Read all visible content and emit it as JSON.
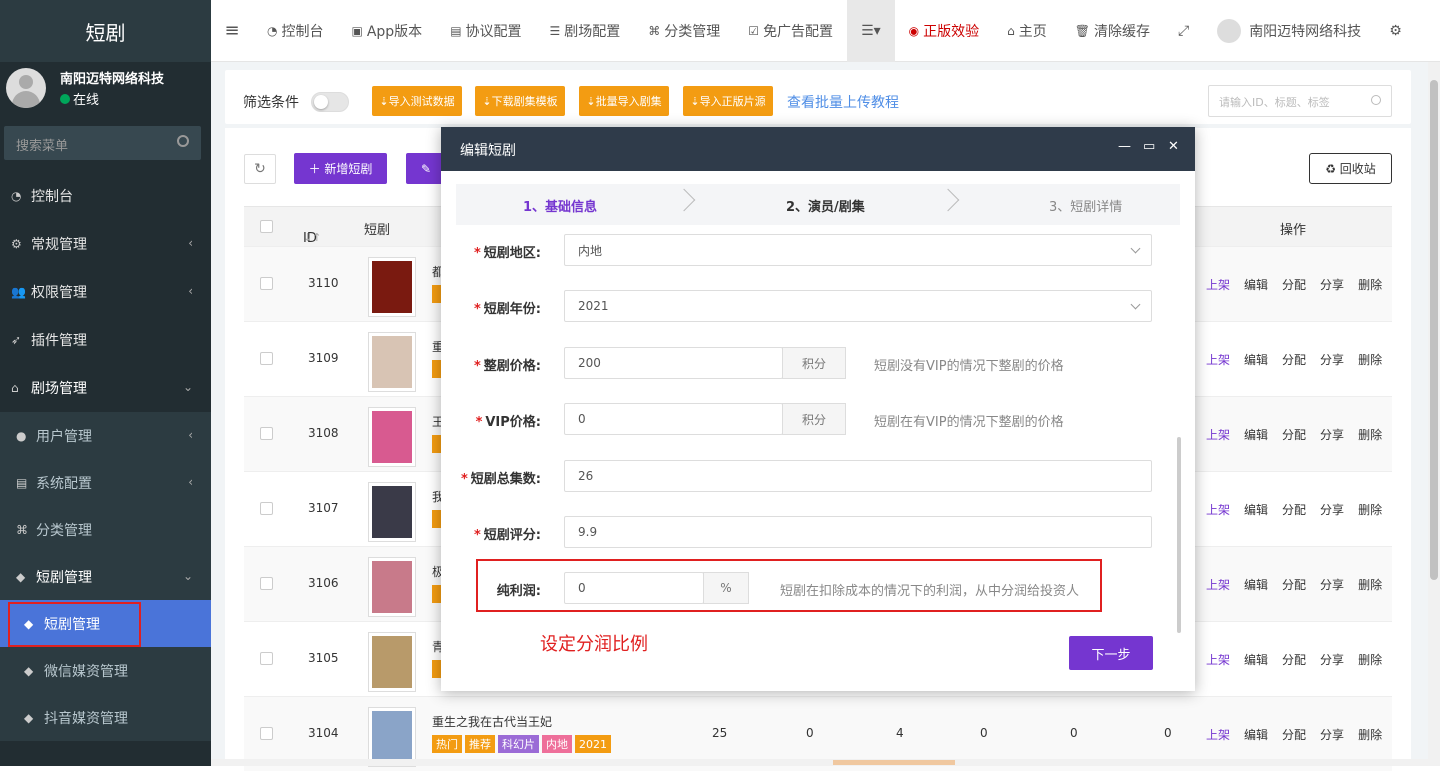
{
  "app": {
    "brand": "短剧"
  },
  "user": {
    "name": "南阳迈特网络科技",
    "status": "在线"
  },
  "sidebar": {
    "search_placeholder": "搜索菜单",
    "items": [
      {
        "label": "控制台",
        "icon": "dashboard-icon"
      },
      {
        "label": "常规管理",
        "icon": "cogs-icon"
      },
      {
        "label": "权限管理",
        "icon": "group-icon"
      },
      {
        "label": "插件管理",
        "icon": "rocket-icon"
      },
      {
        "label": "剧场管理",
        "icon": "home-icon"
      }
    ],
    "sub_items": [
      {
        "label": "用户管理",
        "icon": "user-icon"
      },
      {
        "label": "系统配置",
        "icon": "file-icon"
      },
      {
        "label": "分类管理",
        "icon": "sitemap-icon"
      },
      {
        "label": "短剧管理",
        "icon": "shopping-bag-icon"
      }
    ],
    "sub2_items": [
      {
        "label": "短剧管理",
        "icon": "shopping-bag-icon"
      },
      {
        "label": "微信媒资管理",
        "icon": "shopping-bag-icon"
      },
      {
        "label": "抖音媒资管理",
        "icon": "shopping-bag-icon"
      }
    ]
  },
  "topbar": {
    "items": [
      {
        "label": "控制台",
        "icon": "dashboard-icon"
      },
      {
        "label": "App版本",
        "icon": "image-icon"
      },
      {
        "label": "协议配置",
        "icon": "file-icon"
      },
      {
        "label": "剧场配置",
        "icon": "sliders-icon"
      },
      {
        "label": "分类管理",
        "icon": "sitemap-icon"
      },
      {
        "label": "免广告配置",
        "icon": "check-square-icon"
      }
    ],
    "trial": "正版效验",
    "home": "主页",
    "clear_cache": "清除缓存",
    "account": "南阳迈特网络科技"
  },
  "toolbar": {
    "filter_label": "筛选条件",
    "buttons": [
      "导入测试数据",
      "下载剧集模板",
      "批量导入剧集",
      "导入正版片源"
    ],
    "tutorial_link": "查看批量上传教程",
    "search_placeholder": "请输入ID、标题、标签"
  },
  "panel": {
    "add_button": "新增短剧",
    "recycle_button": "回收站",
    "columns": {
      "id": "ID",
      "drama": "短剧",
      "ops": "操作"
    }
  },
  "rows": [
    {
      "id": "3110",
      "title": "都",
      "tags": [],
      "thumb": "#7a1a10"
    },
    {
      "id": "3109",
      "title": "重",
      "tags": [],
      "thumb": "#d8c4b4"
    },
    {
      "id": "3108",
      "title": "王",
      "tags": [],
      "thumb": "#d85a90"
    },
    {
      "id": "3107",
      "title": "我",
      "tags": [],
      "thumb": "#3a3a48"
    },
    {
      "id": "3106",
      "title": "极",
      "tags": [],
      "thumb": "#c87a8a"
    },
    {
      "id": "3105",
      "title": "青",
      "tags": [],
      "thumb": "#b89a6a"
    },
    {
      "id": "3104",
      "title": "重生之我在古代当王妃",
      "tags": [
        "热门",
        "推荐",
        "科幻片",
        "内地",
        "2021"
      ],
      "thumb": "#8aa4c8",
      "nums": [
        "25",
        "0",
        "4",
        "0",
        "0",
        "0"
      ]
    }
  ],
  "row_ops": [
    "上架",
    "编辑",
    "分配",
    "分享",
    "删除"
  ],
  "modal": {
    "title": "编辑短剧",
    "steps": [
      "1、基础信息",
      "2、演员/剧集",
      "3、短剧详情"
    ],
    "fields": {
      "region": {
        "label": "短剧地区:",
        "value": "内地"
      },
      "year": {
        "label": "短剧年份:",
        "value": "2021"
      },
      "price": {
        "label": "整剧价格:",
        "value": "200",
        "unit": "积分",
        "hint": "短剧没有VIP的情况下整剧的价格"
      },
      "vip_price": {
        "label": "VIP价格:",
        "value": "0",
        "unit": "积分",
        "hint": "短剧在有VIP的情况下整剧的价格"
      },
      "episodes": {
        "label": "短剧总集数:",
        "value": "26"
      },
      "score": {
        "label": "短剧评分:",
        "value": "9.9"
      },
      "profit": {
        "label": "纯利润:",
        "value": "0",
        "unit": "%",
        "hint": "短剧在扣除成本的情况下的利润，从中分润给投资人"
      }
    },
    "annotation": "设定分润比例",
    "next_button": "下一步"
  }
}
